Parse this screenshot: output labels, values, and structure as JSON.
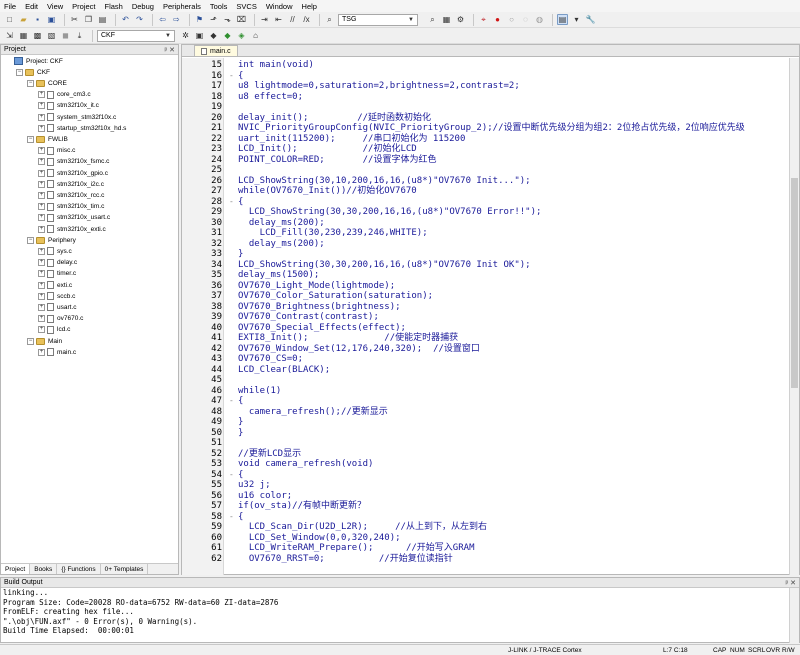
{
  "menu": [
    "File",
    "Edit",
    "View",
    "Project",
    "Flash",
    "Debug",
    "Peripherals",
    "Tools",
    "SVCS",
    "Window",
    "Help"
  ],
  "toolbar": {
    "find_combo": "TSG",
    "target_combo": "CKF"
  },
  "project_panel": {
    "title": "Project",
    "tree": [
      {
        "label": "Project: CKF",
        "level": 0,
        "kind": "root"
      },
      {
        "label": "CKF",
        "level": 1,
        "kind": "folder"
      },
      {
        "label": "CORE",
        "level": 2,
        "kind": "folder"
      },
      {
        "label": "core_cm3.c",
        "level": 3,
        "kind": "file"
      },
      {
        "label": "stm32f10x_it.c",
        "level": 3,
        "kind": "file"
      },
      {
        "label": "system_stm32f10x.c",
        "level": 3,
        "kind": "file"
      },
      {
        "label": "startup_stm32f10x_hd.s",
        "level": 3,
        "kind": "file"
      },
      {
        "label": "FWLIB",
        "level": 2,
        "kind": "folder"
      },
      {
        "label": "misc.c",
        "level": 3,
        "kind": "file"
      },
      {
        "label": "stm32f10x_fsmc.c",
        "level": 3,
        "kind": "file"
      },
      {
        "label": "stm32f10x_gpio.c",
        "level": 3,
        "kind": "file"
      },
      {
        "label": "stm32f10x_i2c.c",
        "level": 3,
        "kind": "file"
      },
      {
        "label": "stm32f10x_rcc.c",
        "level": 3,
        "kind": "file"
      },
      {
        "label": "stm32f10x_tim.c",
        "level": 3,
        "kind": "file"
      },
      {
        "label": "stm32f10x_usart.c",
        "level": 3,
        "kind": "file"
      },
      {
        "label": "stm32f10x_exti.c",
        "level": 3,
        "kind": "file"
      },
      {
        "label": "Periphery",
        "level": 2,
        "kind": "folder"
      },
      {
        "label": "sys.c",
        "level": 3,
        "kind": "file"
      },
      {
        "label": "delay.c",
        "level": 3,
        "kind": "file"
      },
      {
        "label": "timer.c",
        "level": 3,
        "kind": "file"
      },
      {
        "label": "exti.c",
        "level": 3,
        "kind": "file"
      },
      {
        "label": "sccb.c",
        "level": 3,
        "kind": "file"
      },
      {
        "label": "usart.c",
        "level": 3,
        "kind": "file"
      },
      {
        "label": "ov7670.c",
        "level": 3,
        "kind": "file"
      },
      {
        "label": "lcd.c",
        "level": 3,
        "kind": "file"
      },
      {
        "label": "Main",
        "level": 2,
        "kind": "folder"
      },
      {
        "label": "main.c",
        "level": 3,
        "kind": "file"
      }
    ],
    "tabs": [
      "Project",
      "Books",
      "{} Functions",
      "0+ Templates"
    ]
  },
  "editor": {
    "tab": "main.c",
    "lines": [
      {
        "n": "15",
        "t": "int main(void)",
        "fold": ""
      },
      {
        "n": "16",
        "t": "{",
        "fold": "-"
      },
      {
        "n": "17",
        "t": "u8 lightmode=0,saturation=2,brightness=2,contrast=2;",
        "fold": ""
      },
      {
        "n": "18",
        "t": "u8 effect=0;",
        "fold": ""
      },
      {
        "n": "19",
        "t": "",
        "fold": ""
      },
      {
        "n": "20",
        "t": "delay_init();         //延时函数初始化",
        "fold": ""
      },
      {
        "n": "21",
        "t": "NVIC_PriorityGroupConfig(NVIC_PriorityGroup_2);//设置中断优先级分组为组2：2位抢占优先级，2位响应优先级",
        "fold": ""
      },
      {
        "n": "22",
        "t": "uart_init(115200);     //串口初始化为 115200",
        "fold": ""
      },
      {
        "n": "23",
        "t": "LCD_Init();            //初始化LCD",
        "fold": ""
      },
      {
        "n": "24",
        "t": "POINT_COLOR=RED;       //设置字体为红色",
        "fold": ""
      },
      {
        "n": "25",
        "t": "",
        "fold": ""
      },
      {
        "n": "26",
        "t": "LCD_ShowString(30,10,200,16,16,(u8*)\"OV7670 Init...\");",
        "fold": ""
      },
      {
        "n": "27",
        "t": "while(OV7670_Init())//初始化OV7670",
        "fold": ""
      },
      {
        "n": "28",
        "t": "{",
        "fold": "-"
      },
      {
        "n": "29",
        "t": "  LCD_ShowString(30,30,200,16,16,(u8*)\"OV7670 Error!!\");",
        "fold": ""
      },
      {
        "n": "30",
        "t": "  delay_ms(200);",
        "fold": ""
      },
      {
        "n": "31",
        "t": "    LCD_Fill(30,230,239,246,WHITE);",
        "fold": ""
      },
      {
        "n": "32",
        "t": "  delay_ms(200);",
        "fold": ""
      },
      {
        "n": "33",
        "t": "}",
        "fold": ""
      },
      {
        "n": "34",
        "t": "LCD_ShowString(30,30,200,16,16,(u8*)\"OV7670 Init OK\");",
        "fold": ""
      },
      {
        "n": "35",
        "t": "delay_ms(1500);",
        "fold": ""
      },
      {
        "n": "36",
        "t": "OV7670_Light_Mode(lightmode);",
        "fold": ""
      },
      {
        "n": "37",
        "t": "OV7670_Color_Saturation(saturation);",
        "fold": ""
      },
      {
        "n": "38",
        "t": "OV7670_Brightness(brightness);",
        "fold": ""
      },
      {
        "n": "39",
        "t": "OV7670_Contrast(contrast);",
        "fold": ""
      },
      {
        "n": "40",
        "t": "OV7670_Special_Effects(effect);",
        "fold": ""
      },
      {
        "n": "41",
        "t": "EXTI8_Init();              //使能定时器捕获",
        "fold": ""
      },
      {
        "n": "42",
        "t": "OV7670_Window_Set(12,176,240,320);  //设置窗口",
        "fold": ""
      },
      {
        "n": "43",
        "t": "OV7670_CS=0;",
        "fold": ""
      },
      {
        "n": "44",
        "t": "LCD_Clear(BLACK);",
        "fold": ""
      },
      {
        "n": "45",
        "t": "",
        "fold": ""
      },
      {
        "n": "46",
        "t": "while(1)",
        "fold": ""
      },
      {
        "n": "47",
        "t": "{",
        "fold": "-"
      },
      {
        "n": "48",
        "t": "  camera_refresh();//更新显示",
        "fold": ""
      },
      {
        "n": "49",
        "t": "}",
        "fold": ""
      },
      {
        "n": "50",
        "t": "}",
        "fold": ""
      },
      {
        "n": "51",
        "t": "",
        "fold": ""
      },
      {
        "n": "52",
        "t": "//更新LCD显示",
        "fold": ""
      },
      {
        "n": "53",
        "t": "void camera_refresh(void)",
        "fold": ""
      },
      {
        "n": "54",
        "t": "{",
        "fold": "-"
      },
      {
        "n": "55",
        "t": "u32 j;",
        "fold": ""
      },
      {
        "n": "56",
        "t": "u16 color;",
        "fold": ""
      },
      {
        "n": "57",
        "t": "if(ov_sta)//有帧中断更新？",
        "fold": ""
      },
      {
        "n": "58",
        "t": "{",
        "fold": "-"
      },
      {
        "n": "59",
        "t": "  LCD_Scan_Dir(U2D_L2R);     //从上到下，从左到右",
        "fold": ""
      },
      {
        "n": "60",
        "t": "  LCD_Set_Window(0,0,320,240);",
        "fold": ""
      },
      {
        "n": "61",
        "t": "  LCD_WriteRAM_Prepare();      //开始写入GRAM",
        "fold": ""
      },
      {
        "n": "62",
        "t": "  OV7670_RRST=0;          //开始复位读指针",
        "fold": ""
      }
    ]
  },
  "build_output": {
    "title": "Build Output",
    "lines": [
      "linking...",
      "Program Size: Code=20028 RO-data=6752 RW-data=60 ZI-data=2876",
      "FromELF: creating hex file...",
      "\".\\obj\\FUN.axf\" - 0 Error(s), 0 Warning(s).",
      "Build Time Elapsed:  00:00:01"
    ]
  },
  "status": {
    "debugger": "J-LINK / J-TRACE Cortex",
    "position": "L:7 C:18",
    "caps": "CAP",
    "num": "NUM",
    "scrl": "SCRL",
    "ovr": "OVR",
    "rw": "R/W"
  }
}
